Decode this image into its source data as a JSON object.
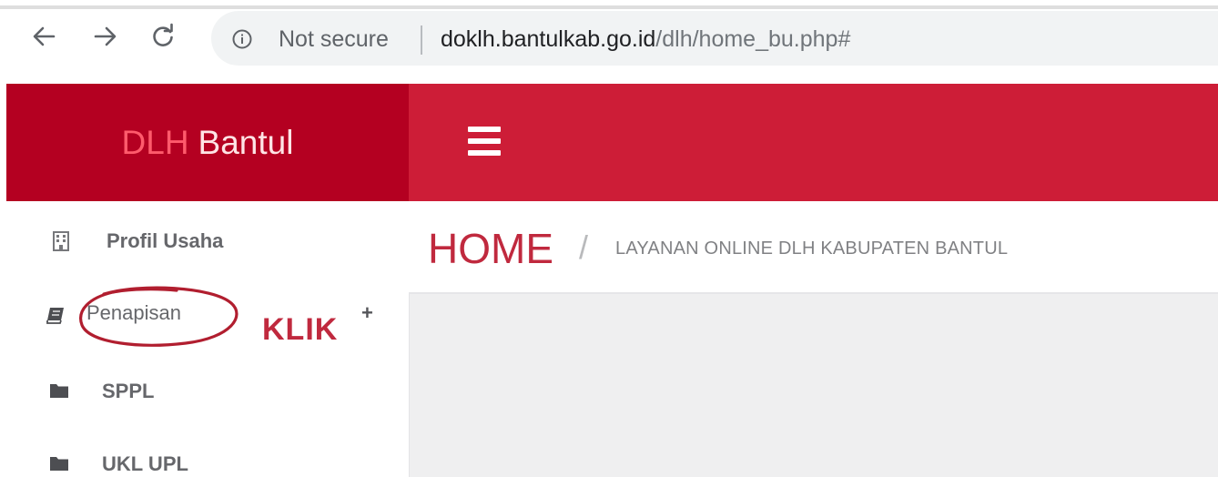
{
  "browser": {
    "security_text": "Not secure",
    "url_host": "doklh.bantulkab.go.id",
    "url_path": "/dlh/home_bu.php#"
  },
  "brand": {
    "part1": "DLH",
    "part2": "Bantul"
  },
  "sidebar": {
    "items": [
      {
        "label": "Profil Usaha",
        "icon": "building-icon"
      },
      {
        "label": "Penapisan",
        "icon": "book-icon",
        "expander": "+"
      },
      {
        "label": "SPPL",
        "icon": "folder-icon"
      },
      {
        "label": "UKL UPL",
        "icon": "folder-icon"
      }
    ]
  },
  "annotation": {
    "text": "KLIK",
    "color": "#c0293e"
  },
  "breadcrumb": {
    "home": "HOME",
    "separator": "/",
    "subtitle": "LAYANAN ONLINE DLH KABUPATEN BANTUL"
  },
  "colors": {
    "brand_bg": "#b40021",
    "topbar_bg": "#cd1d37",
    "accent": "#c0293e"
  }
}
